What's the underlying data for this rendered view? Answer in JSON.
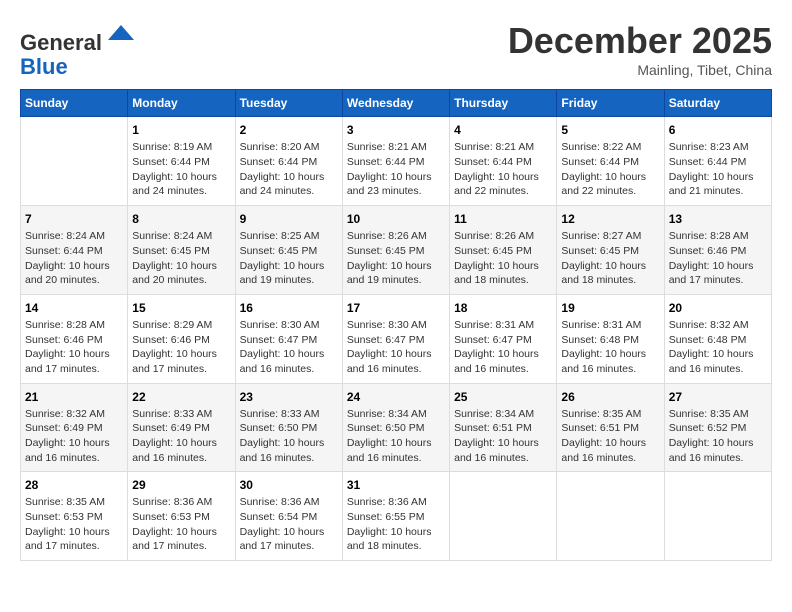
{
  "header": {
    "logo_general": "General",
    "logo_blue": "Blue",
    "month_title": "December 2025",
    "location": "Mainling, Tibet, China"
  },
  "calendar": {
    "days_of_week": [
      "Sunday",
      "Monday",
      "Tuesday",
      "Wednesday",
      "Thursday",
      "Friday",
      "Saturday"
    ],
    "weeks": [
      [
        {
          "day": "",
          "info": ""
        },
        {
          "day": "1",
          "info": "Sunrise: 8:19 AM\nSunset: 6:44 PM\nDaylight: 10 hours\nand 24 minutes."
        },
        {
          "day": "2",
          "info": "Sunrise: 8:20 AM\nSunset: 6:44 PM\nDaylight: 10 hours\nand 24 minutes."
        },
        {
          "day": "3",
          "info": "Sunrise: 8:21 AM\nSunset: 6:44 PM\nDaylight: 10 hours\nand 23 minutes."
        },
        {
          "day": "4",
          "info": "Sunrise: 8:21 AM\nSunset: 6:44 PM\nDaylight: 10 hours\nand 22 minutes."
        },
        {
          "day": "5",
          "info": "Sunrise: 8:22 AM\nSunset: 6:44 PM\nDaylight: 10 hours\nand 22 minutes."
        },
        {
          "day": "6",
          "info": "Sunrise: 8:23 AM\nSunset: 6:44 PM\nDaylight: 10 hours\nand 21 minutes."
        }
      ],
      [
        {
          "day": "7",
          "info": "Sunrise: 8:24 AM\nSunset: 6:44 PM\nDaylight: 10 hours\nand 20 minutes."
        },
        {
          "day": "8",
          "info": "Sunrise: 8:24 AM\nSunset: 6:45 PM\nDaylight: 10 hours\nand 20 minutes."
        },
        {
          "day": "9",
          "info": "Sunrise: 8:25 AM\nSunset: 6:45 PM\nDaylight: 10 hours\nand 19 minutes."
        },
        {
          "day": "10",
          "info": "Sunrise: 8:26 AM\nSunset: 6:45 PM\nDaylight: 10 hours\nand 19 minutes."
        },
        {
          "day": "11",
          "info": "Sunrise: 8:26 AM\nSunset: 6:45 PM\nDaylight: 10 hours\nand 18 minutes."
        },
        {
          "day": "12",
          "info": "Sunrise: 8:27 AM\nSunset: 6:45 PM\nDaylight: 10 hours\nand 18 minutes."
        },
        {
          "day": "13",
          "info": "Sunrise: 8:28 AM\nSunset: 6:46 PM\nDaylight: 10 hours\nand 17 minutes."
        }
      ],
      [
        {
          "day": "14",
          "info": "Sunrise: 8:28 AM\nSunset: 6:46 PM\nDaylight: 10 hours\nand 17 minutes."
        },
        {
          "day": "15",
          "info": "Sunrise: 8:29 AM\nSunset: 6:46 PM\nDaylight: 10 hours\nand 17 minutes."
        },
        {
          "day": "16",
          "info": "Sunrise: 8:30 AM\nSunset: 6:47 PM\nDaylight: 10 hours\nand 16 minutes."
        },
        {
          "day": "17",
          "info": "Sunrise: 8:30 AM\nSunset: 6:47 PM\nDaylight: 10 hours\nand 16 minutes."
        },
        {
          "day": "18",
          "info": "Sunrise: 8:31 AM\nSunset: 6:47 PM\nDaylight: 10 hours\nand 16 minutes."
        },
        {
          "day": "19",
          "info": "Sunrise: 8:31 AM\nSunset: 6:48 PM\nDaylight: 10 hours\nand 16 minutes."
        },
        {
          "day": "20",
          "info": "Sunrise: 8:32 AM\nSunset: 6:48 PM\nDaylight: 10 hours\nand 16 minutes."
        }
      ],
      [
        {
          "day": "21",
          "info": "Sunrise: 8:32 AM\nSunset: 6:49 PM\nDaylight: 10 hours\nand 16 minutes."
        },
        {
          "day": "22",
          "info": "Sunrise: 8:33 AM\nSunset: 6:49 PM\nDaylight: 10 hours\nand 16 minutes."
        },
        {
          "day": "23",
          "info": "Sunrise: 8:33 AM\nSunset: 6:50 PM\nDaylight: 10 hours\nand 16 minutes."
        },
        {
          "day": "24",
          "info": "Sunrise: 8:34 AM\nSunset: 6:50 PM\nDaylight: 10 hours\nand 16 minutes."
        },
        {
          "day": "25",
          "info": "Sunrise: 8:34 AM\nSunset: 6:51 PM\nDaylight: 10 hours\nand 16 minutes."
        },
        {
          "day": "26",
          "info": "Sunrise: 8:35 AM\nSunset: 6:51 PM\nDaylight: 10 hours\nand 16 minutes."
        },
        {
          "day": "27",
          "info": "Sunrise: 8:35 AM\nSunset: 6:52 PM\nDaylight: 10 hours\nand 16 minutes."
        }
      ],
      [
        {
          "day": "28",
          "info": "Sunrise: 8:35 AM\nSunset: 6:53 PM\nDaylight: 10 hours\nand 17 minutes."
        },
        {
          "day": "29",
          "info": "Sunrise: 8:36 AM\nSunset: 6:53 PM\nDaylight: 10 hours\nand 17 minutes."
        },
        {
          "day": "30",
          "info": "Sunrise: 8:36 AM\nSunset: 6:54 PM\nDaylight: 10 hours\nand 17 minutes."
        },
        {
          "day": "31",
          "info": "Sunrise: 8:36 AM\nSunset: 6:55 PM\nDaylight: 10 hours\nand 18 minutes."
        },
        {
          "day": "",
          "info": ""
        },
        {
          "day": "",
          "info": ""
        },
        {
          "day": "",
          "info": ""
        }
      ]
    ]
  }
}
